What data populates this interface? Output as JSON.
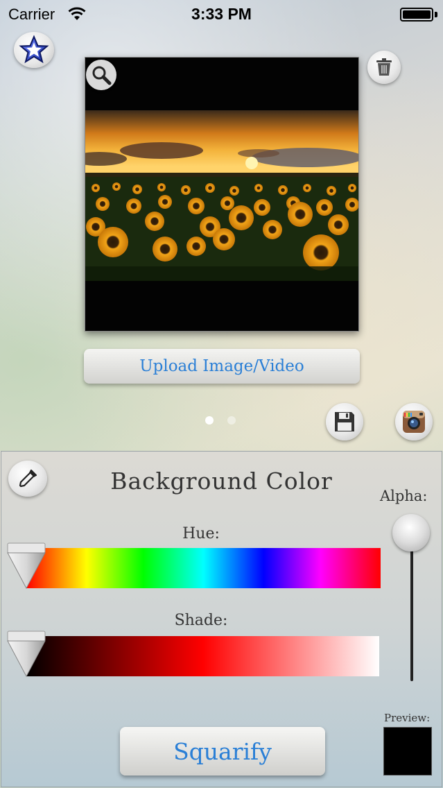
{
  "status_bar": {
    "carrier": "Carrier",
    "time": "3:33 PM"
  },
  "main": {
    "upload_label": "Upload Image/Video",
    "pages": {
      "total": 2,
      "current": 1
    }
  },
  "color_panel": {
    "title": "Background Color",
    "hue_label": "Hue:",
    "shade_label": "Shade:",
    "alpha_label": "Alpha:",
    "preview_label": "Preview:",
    "squarify_label": "Squarify",
    "hue_value": 0.0,
    "shade_value": 0.0,
    "alpha_value": 1.0,
    "preview_color": "#000000"
  },
  "colors": {
    "accent": "#2a7fd6"
  },
  "icons": [
    "star-icon",
    "trash-icon",
    "zoom-icon",
    "save-icon",
    "instagram-icon",
    "eyedropper-icon",
    "wifi-icon",
    "battery-icon"
  ]
}
